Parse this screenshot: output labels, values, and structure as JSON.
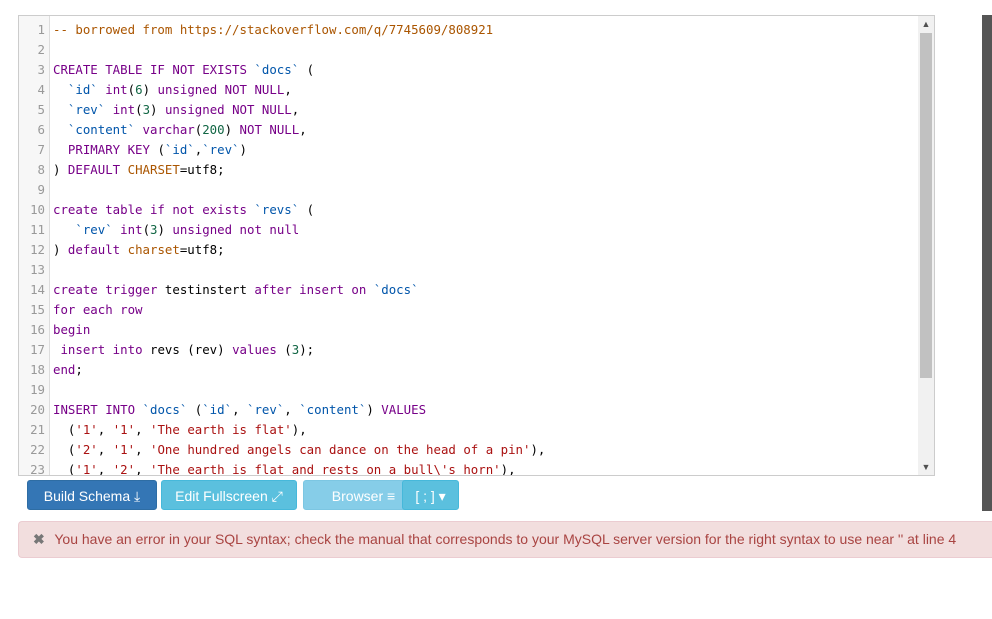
{
  "editor": {
    "lines": [
      {
        "n": "1",
        "tokens": [
          [
            "cm",
            "-- borrowed from https://stackoverflow.com/q/7745609/808921"
          ]
        ]
      },
      {
        "n": "2",
        "tokens": []
      },
      {
        "n": "3",
        "tokens": [
          [
            "kw",
            "CREATE TABLE IF NOT EXISTS "
          ],
          [
            "bt",
            "`docs`"
          ],
          [
            "plain",
            " ("
          ]
        ]
      },
      {
        "n": "4",
        "tokens": [
          [
            "plain",
            "  "
          ],
          [
            "bt",
            "`id`"
          ],
          [
            "plain",
            " "
          ],
          [
            "kw",
            "int"
          ],
          [
            "plain",
            "("
          ],
          [
            "num",
            "6"
          ],
          [
            "plain",
            ") "
          ],
          [
            "kw",
            "unsigned NOT NULL"
          ],
          [
            "plain",
            ","
          ]
        ]
      },
      {
        "n": "5",
        "tokens": [
          [
            "plain",
            "  "
          ],
          [
            "bt",
            "`rev`"
          ],
          [
            "plain",
            " "
          ],
          [
            "kw",
            "int"
          ],
          [
            "plain",
            "("
          ],
          [
            "num",
            "3"
          ],
          [
            "plain",
            ") "
          ],
          [
            "kw",
            "unsigned NOT NULL"
          ],
          [
            "plain",
            ","
          ]
        ]
      },
      {
        "n": "6",
        "tokens": [
          [
            "plain",
            "  "
          ],
          [
            "bt",
            "`content`"
          ],
          [
            "plain",
            " "
          ],
          [
            "kw",
            "varchar"
          ],
          [
            "plain",
            "("
          ],
          [
            "num",
            "200"
          ],
          [
            "plain",
            ") "
          ],
          [
            "kw",
            "NOT NULL"
          ],
          [
            "plain",
            ","
          ]
        ]
      },
      {
        "n": "7",
        "tokens": [
          [
            "plain",
            "  "
          ],
          [
            "kw",
            "PRIMARY KEY"
          ],
          [
            "plain",
            " ("
          ],
          [
            "bt",
            "`id`"
          ],
          [
            "plain",
            ","
          ],
          [
            "bt",
            "`rev`"
          ],
          [
            "plain",
            ")"
          ]
        ]
      },
      {
        "n": "8",
        "tokens": [
          [
            "plain",
            ") "
          ],
          [
            "kw",
            "DEFAULT "
          ],
          [
            "cm",
            "CHARSET"
          ],
          [
            "plain",
            "=utf8;"
          ]
        ]
      },
      {
        "n": "9",
        "tokens": []
      },
      {
        "n": "10",
        "tokens": [
          [
            "kw",
            "create table if not exists "
          ],
          [
            "bt",
            "`revs`"
          ],
          [
            "plain",
            " ("
          ]
        ]
      },
      {
        "n": "11",
        "tokens": [
          [
            "plain",
            "   "
          ],
          [
            "bt",
            "`rev`"
          ],
          [
            "plain",
            " "
          ],
          [
            "kw",
            "int"
          ],
          [
            "plain",
            "("
          ],
          [
            "num",
            "3"
          ],
          [
            "plain",
            ") "
          ],
          [
            "kw",
            "unsigned not null"
          ]
        ]
      },
      {
        "n": "12",
        "tokens": [
          [
            "plain",
            ") "
          ],
          [
            "kw",
            "default "
          ],
          [
            "cm",
            "charset"
          ],
          [
            "plain",
            "=utf8;"
          ]
        ]
      },
      {
        "n": "13",
        "tokens": []
      },
      {
        "n": "14",
        "tokens": [
          [
            "kw",
            "create trigger"
          ],
          [
            "plain",
            " testinstert "
          ],
          [
            "kw",
            "after insert on "
          ],
          [
            "bt",
            "`docs`"
          ]
        ]
      },
      {
        "n": "15",
        "tokens": [
          [
            "kw",
            "for each row"
          ]
        ]
      },
      {
        "n": "16",
        "tokens": [
          [
            "kw",
            "begin"
          ]
        ]
      },
      {
        "n": "17",
        "tokens": [
          [
            "plain",
            " "
          ],
          [
            "kw",
            "insert into"
          ],
          [
            "plain",
            " revs (rev) "
          ],
          [
            "kw",
            "values"
          ],
          [
            "plain",
            " ("
          ],
          [
            "num",
            "3"
          ],
          [
            "plain",
            ");"
          ]
        ]
      },
      {
        "n": "18",
        "tokens": [
          [
            "kw",
            "end"
          ],
          [
            "plain",
            ";"
          ]
        ]
      },
      {
        "n": "19",
        "tokens": []
      },
      {
        "n": "20",
        "tokens": [
          [
            "kw",
            "INSERT INTO "
          ],
          [
            "bt",
            "`docs`"
          ],
          [
            "plain",
            " ("
          ],
          [
            "bt",
            "`id`"
          ],
          [
            "plain",
            ", "
          ],
          [
            "bt",
            "`rev`"
          ],
          [
            "plain",
            ", "
          ],
          [
            "bt",
            "`content`"
          ],
          [
            "plain",
            ") "
          ],
          [
            "kw",
            "VALUES"
          ]
        ]
      },
      {
        "n": "21",
        "tokens": [
          [
            "plain",
            "  ("
          ],
          [
            "str",
            "'1'"
          ],
          [
            "plain",
            ", "
          ],
          [
            "str",
            "'1'"
          ],
          [
            "plain",
            ", "
          ],
          [
            "str",
            "'The earth is flat'"
          ],
          [
            "plain",
            "),"
          ]
        ]
      },
      {
        "n": "22",
        "tokens": [
          [
            "plain",
            "  ("
          ],
          [
            "str",
            "'2'"
          ],
          [
            "plain",
            ", "
          ],
          [
            "str",
            "'1'"
          ],
          [
            "plain",
            ", "
          ],
          [
            "str",
            "'One hundred angels can dance on the head of a pin'"
          ],
          [
            "plain",
            "),"
          ]
        ]
      },
      {
        "n": "23",
        "tokens": [
          [
            "plain",
            "  ("
          ],
          [
            "str",
            "'1'"
          ],
          [
            "plain",
            ", "
          ],
          [
            "str",
            "'2'"
          ],
          [
            "plain",
            ", "
          ],
          [
            "str",
            "'The earth is flat and rests on a bull\\'s horn'"
          ],
          [
            "plain",
            "),"
          ]
        ]
      }
    ]
  },
  "toolbar": {
    "build_label": "Build Schema",
    "build_icon": "download-icon",
    "edit_label": "Edit Fullscreen",
    "edit_icon": "expand-icon",
    "browser_label": "Browser",
    "browser_icon": "tree-icon",
    "delimiter_label": "[ ; ]"
  },
  "error": {
    "message": "You have an error in your SQL syntax; check the manual that corresponds to your MySQL server version for the right syntax to use near '' at line 4"
  }
}
